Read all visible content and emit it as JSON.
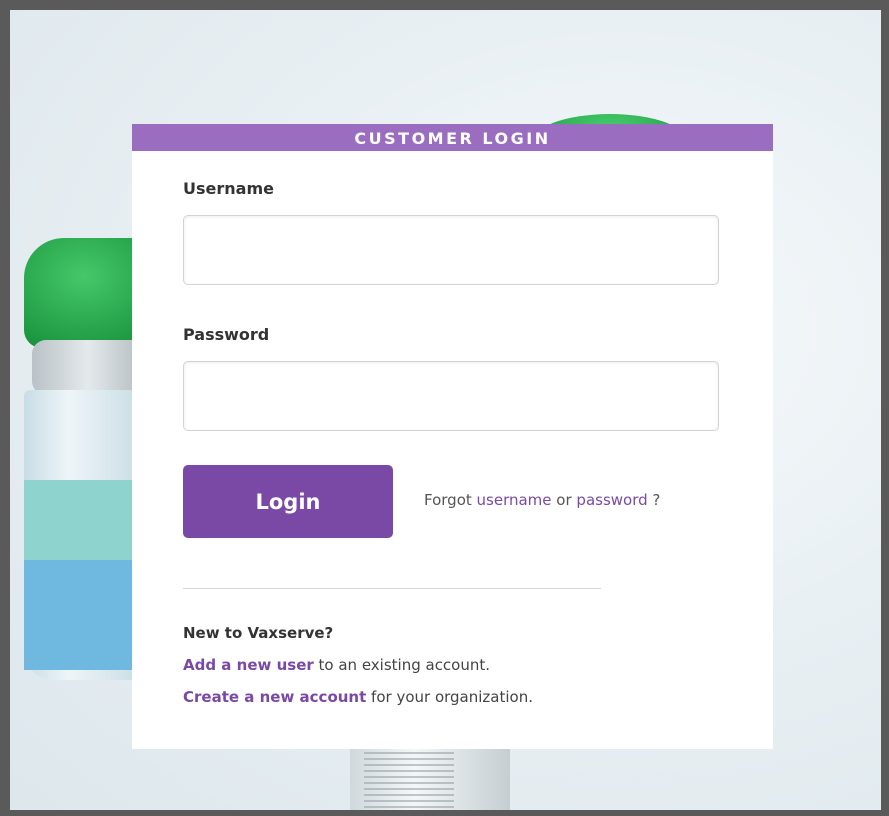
{
  "panel": {
    "title": "CUSTOMER LOGIN"
  },
  "form": {
    "username_label": "Username",
    "username_value": "",
    "password_label": "Password",
    "password_value": "",
    "login_label": "Login",
    "forgot_prefix": "Forgot ",
    "forgot_username": "username",
    "forgot_or": " or ",
    "forgot_password": "password",
    "forgot_suffix": " ?"
  },
  "signup": {
    "title": "New to Vaxserve?",
    "add_user_link": "Add a new user",
    "add_user_rest": " to an existing account.",
    "create_account_link": "Create a new account",
    "create_account_rest": " for your organization."
  },
  "colors": {
    "accent": "#7a49a5",
    "header_bg": "#9b6dc0"
  }
}
